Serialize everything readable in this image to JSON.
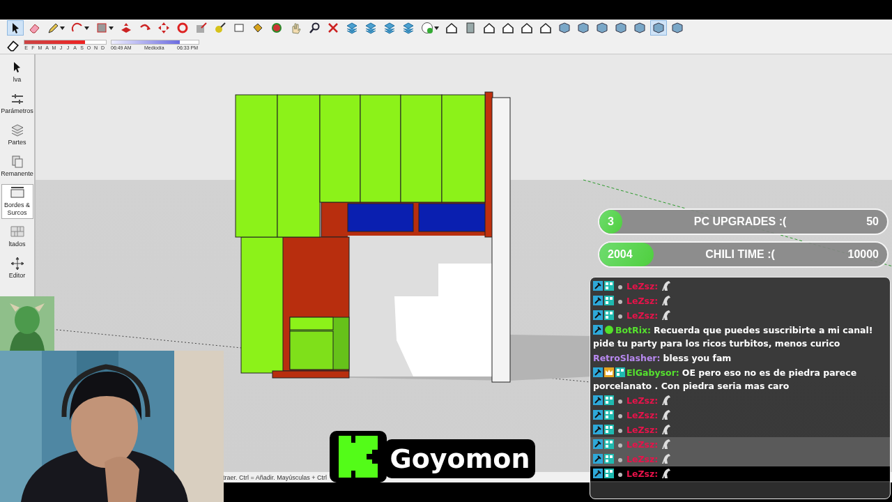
{
  "toolbar": {
    "tools": [
      {
        "kind": "select",
        "selected": true,
        "menu": false
      },
      {
        "kind": "eraser",
        "selected": false,
        "menu": false
      },
      {
        "kind": "pencil",
        "selected": false,
        "menu": true
      },
      {
        "kind": "arc",
        "selected": false,
        "menu": true
      },
      {
        "kind": "rectangle",
        "selected": false,
        "menu": true
      },
      {
        "kind": "pushpull",
        "selected": false,
        "menu": false
      },
      {
        "kind": "followme",
        "selected": false,
        "menu": false
      },
      {
        "kind": "move",
        "selected": false,
        "menu": false
      },
      {
        "kind": "rotate",
        "selected": false,
        "menu": false
      },
      {
        "kind": "scale",
        "selected": false,
        "menu": false
      },
      {
        "kind": "tape",
        "selected": false,
        "menu": false
      },
      {
        "kind": "text",
        "selected": false,
        "menu": false
      },
      {
        "kind": "paint",
        "selected": false,
        "menu": false
      },
      {
        "kind": "orbit",
        "selected": false,
        "menu": false
      },
      {
        "kind": "pan",
        "selected": false,
        "menu": false
      },
      {
        "kind": "zoom",
        "selected": false,
        "menu": false
      },
      {
        "kind": "extents",
        "selected": false,
        "menu": false
      },
      {
        "kind": "section",
        "selected": false,
        "menu": false
      },
      {
        "kind": "section",
        "selected": false,
        "menu": false
      },
      {
        "kind": "section",
        "selected": false,
        "menu": false
      },
      {
        "kind": "section",
        "selected": false,
        "menu": false
      },
      {
        "kind": "profile",
        "selected": false,
        "menu": true
      },
      {
        "kind": "house",
        "selected": false,
        "menu": false
      },
      {
        "kind": "box",
        "selected": false,
        "menu": false
      },
      {
        "kind": "house",
        "selected": false,
        "menu": false
      },
      {
        "kind": "house",
        "selected": false,
        "menu": false
      },
      {
        "kind": "house",
        "selected": false,
        "menu": false
      },
      {
        "kind": "house",
        "selected": false,
        "menu": false
      },
      {
        "kind": "cube",
        "selected": false,
        "menu": false
      },
      {
        "kind": "cube",
        "selected": false,
        "menu": false
      },
      {
        "kind": "cube",
        "selected": false,
        "menu": false
      },
      {
        "kind": "cube",
        "selected": false,
        "menu": false
      },
      {
        "kind": "cube",
        "selected": false,
        "menu": false
      },
      {
        "kind": "cube",
        "selected": true,
        "menu": false
      },
      {
        "kind": "cube",
        "selected": false,
        "menu": false
      }
    ],
    "month_slider": {
      "level": 0.74
    },
    "time_slider": {
      "level": 0.78
    },
    "months": [
      "E",
      "F",
      "M",
      "A",
      "M",
      "J",
      "J",
      "A",
      "S",
      "O",
      "N",
      "D"
    ],
    "sunrise": "06:49 AM",
    "noon": "Mediodía",
    "sunset": "06:33 PM"
  },
  "sidebar": {
    "items": [
      {
        "kind": "select",
        "label": "lva",
        "selected": false
      },
      {
        "kind": "sliders",
        "label": "Parámetros",
        "selected": false
      },
      {
        "kind": "layers",
        "label": "Partes",
        "selected": false
      },
      {
        "kind": "copies",
        "label": "Remanente",
        "selected": false
      },
      {
        "kind": "edges",
        "label": "Bordes & Surcos",
        "selected": true
      },
      {
        "kind": "grid",
        "label": "ltados",
        "selected": false
      },
      {
        "kind": "move",
        "label": "Editor",
        "selected": false
      }
    ]
  },
  "status_bar": {
    "text": "traer. Ctrl = Añadir. Mayúsculas + Ctrl"
  },
  "goals": [
    {
      "current": "3",
      "title": "PC UPGRADES :(",
      "target": "50",
      "level": 0.08
    },
    {
      "current": "2004",
      "title": "CHILI TIME :(",
      "target": "10000",
      "level": 0.19
    }
  ],
  "chat": {
    "messages": [
      {
        "kind": "emote",
        "name": "LeZsz:",
        "color": "#e8124a",
        "highlighted": false,
        "latest": false
      },
      {
        "kind": "emote",
        "name": "LeZsz:",
        "color": "#e8124a",
        "highlighted": false,
        "latest": false
      },
      {
        "kind": "emote",
        "name": "LeZsz:",
        "color": "#e8124a",
        "highlighted": false,
        "latest": false
      },
      {
        "kind": "bot",
        "name": "BotRix:",
        "color": "#55e22e",
        "text": "Recuerda que puedes suscribirte a mi canal! pide tu party para los ricos turbitos, menos curico",
        "highlighted": false,
        "latest": false
      },
      {
        "kind": "plain",
        "name": "RetroSlasher:",
        "color": "#b889f0",
        "text": "bless you fam",
        "highlighted": false,
        "latest": false
      },
      {
        "kind": "sub",
        "name": "ElGabysor:",
        "color": "#55e22e",
        "text": "OE pero eso no es de piedra parece porcelanato . Con piedra seria mas caro",
        "highlighted": false,
        "latest": false
      },
      {
        "kind": "emote",
        "name": "LeZsz:",
        "color": "#e8124a",
        "highlighted": false,
        "latest": false
      },
      {
        "kind": "emote",
        "name": "LeZsz:",
        "color": "#e8124a",
        "highlighted": false,
        "latest": false
      },
      {
        "kind": "emote",
        "name": "LeZsz:",
        "color": "#e8124a",
        "highlighted": false,
        "latest": false
      },
      {
        "kind": "emote",
        "name": "LeZsz:",
        "color": "#e8124a",
        "highlighted": true,
        "latest": false
      },
      {
        "kind": "emote",
        "name": "LeZsz:",
        "color": "#e8124a",
        "highlighted": true,
        "latest": false
      },
      {
        "kind": "emote",
        "name": "LeZsz:",
        "color": "#e8124a",
        "highlighted": false,
        "latest": true
      }
    ]
  },
  "channel": {
    "name": "Goyomon"
  }
}
